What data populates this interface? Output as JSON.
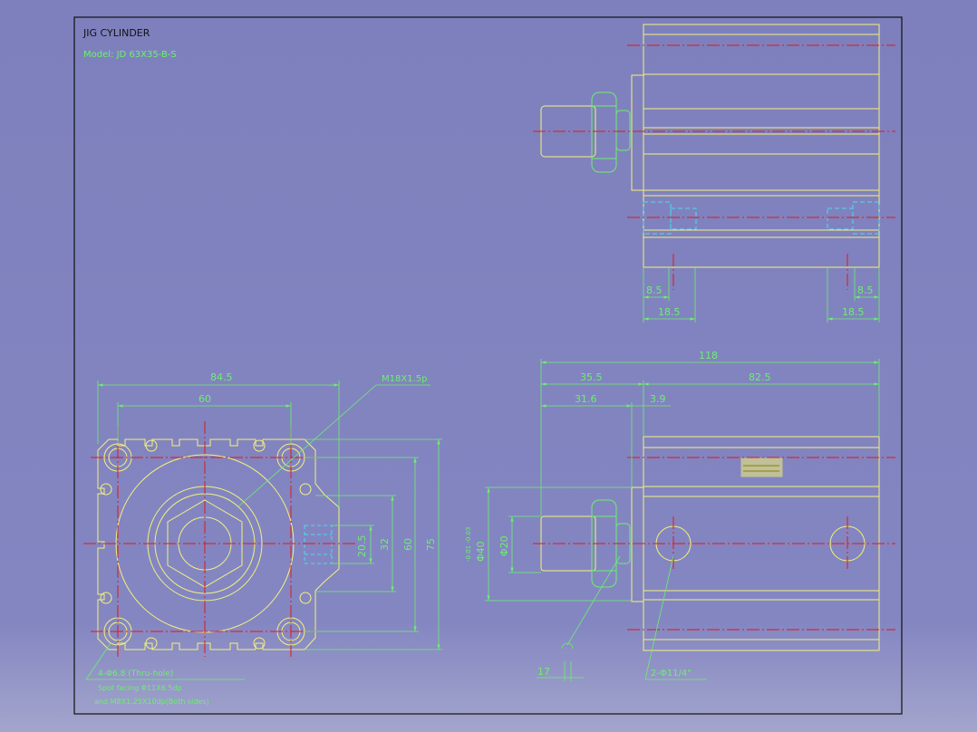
{
  "title_block": {
    "title": "JIG CYLINDER",
    "model": "Model: JD 63X35-B-S"
  },
  "colors": {
    "background": "#7e80bd",
    "outline": "#f4f27a",
    "dimension": "#6cf06c",
    "hidden_line": "#4ed9f2",
    "centerline": "#e01818",
    "frame": "#111111"
  },
  "views": {
    "top": {
      "dims": [
        "8.5",
        "18.5",
        "8.5",
        "18.5"
      ]
    },
    "front": {
      "dims": [
        "84.5",
        "60",
        "20.5",
        "32",
        "60",
        "75"
      ],
      "thread_callout": "M18X1.5p",
      "notes": [
        "4-Φ6.8  (Thru-hole)",
        "Spot facing  Φ11X6.5dp",
        "and M8X1.25X10dp(Both sides)"
      ]
    },
    "side": {
      "dims": [
        "118",
        "35.5",
        "82.5",
        "31.6",
        "3.9",
        "Φ40",
        "Φ20",
        "17"
      ],
      "dim_tol": "-0.01 -0.03",
      "port_callout": "2-Φ11/4\""
    }
  }
}
